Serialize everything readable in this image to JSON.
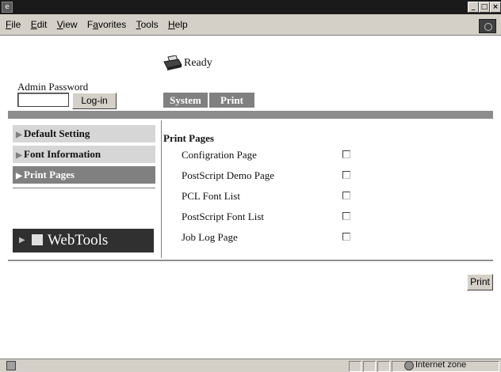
{
  "window": {
    "app_icon": "browser-page-icon",
    "minimize_glyph": "_",
    "maximize_glyph": "□",
    "close_glyph": "×"
  },
  "menubar": {
    "items": [
      {
        "label": "File",
        "underline": "F"
      },
      {
        "label": "Edit",
        "underline": "E"
      },
      {
        "label": "View",
        "underline": "V"
      },
      {
        "label": "Favorites",
        "underline": "a"
      },
      {
        "label": "Tools",
        "underline": "T"
      },
      {
        "label": "Help",
        "underline": "H"
      }
    ]
  },
  "header": {
    "status": "Ready",
    "status_icon": "printer-icon",
    "admin_label": "Admin Password",
    "password_value": "",
    "login_label": "Log-in",
    "tabs": [
      "System",
      "Print"
    ]
  },
  "sidebar": {
    "items": [
      {
        "label": "Default Setting",
        "active": false
      },
      {
        "label": "Font Information",
        "active": false
      },
      {
        "label": "Print Pages",
        "active": true
      }
    ],
    "badge": "WebTools"
  },
  "content": {
    "title": "Print Pages",
    "rows": [
      {
        "label": "Configration Page",
        "checked": false
      },
      {
        "label": "PostScript Demo Page",
        "checked": false
      },
      {
        "label": "PCL Font List",
        "checked": false
      },
      {
        "label": "PostScript Font List",
        "checked": false
      },
      {
        "label": "Job Log Page",
        "checked": false
      }
    ],
    "print_label": "Print"
  },
  "statusbar": {
    "zone": "Internet zone",
    "zone_icon": "globe-icon"
  },
  "colors": {
    "chrome": "#d4d0c8",
    "accent": "#808080",
    "sidebar_item": "#d6d6d6"
  }
}
